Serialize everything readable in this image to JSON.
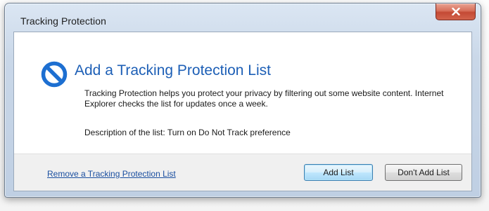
{
  "window": {
    "title": "Tracking Protection",
    "close_glyph": "x",
    "close_icon": "close-icon"
  },
  "dialog": {
    "icon": "block-icon",
    "icon_color": "#1d6fd1",
    "heading": "Add a Tracking Protection List",
    "body": "Tracking Protection helps you protect your privacy by filtering out some website content. Internet Explorer checks the list for updates once a week.",
    "description": "Description of the list: Turn on Do Not Track preference"
  },
  "footer": {
    "remove_link": "Remove a Tracking Protection List",
    "add_button": "Add List",
    "dont_add_button": "Don't Add List"
  },
  "colors": {
    "heading": "#1d5fb6",
    "link": "#1a4fa0",
    "close_button": "#c44a35"
  }
}
